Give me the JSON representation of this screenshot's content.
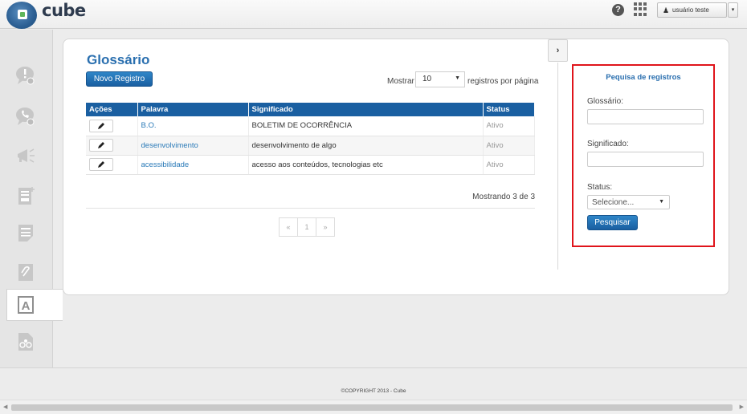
{
  "app": {
    "name": "cube"
  },
  "header": {
    "help_icon": "question-circle-icon",
    "apps_icon": "grid-icon",
    "user_label": "usuário teste",
    "user_icon": "person-icon",
    "caret": "▾"
  },
  "sidebar": {
    "items": [
      {
        "name": "alert-chat-icon"
      },
      {
        "name": "phone-chat-icon"
      },
      {
        "name": "megaphone-icon"
      },
      {
        "name": "add-report-icon"
      },
      {
        "name": "sla-document-icon"
      },
      {
        "name": "attachment-icon"
      },
      {
        "name": "glossary-icon",
        "active": true
      },
      {
        "name": "workflow-document-icon"
      }
    ]
  },
  "main": {
    "title": "Glossário",
    "new_button": "Novo Registro",
    "show_label": "Mostrar",
    "page_size": "10",
    "per_page_label": "registros por página",
    "columns": [
      "Ações",
      "Palavra",
      "Significado",
      "Status"
    ],
    "rows": [
      {
        "palavra": "B.O.",
        "significado": "BOLETIM DE OCORRÊNCIA",
        "status": "Ativo"
      },
      {
        "palavra": "desenvolvimento",
        "significado": "desenvolvimento de algo",
        "status": "Ativo"
      },
      {
        "palavra": "acessibilidade",
        "significado": "acesso aos conteúdos, tecnologias etc",
        "status": "Ativo"
      }
    ],
    "showing": "Mostrando 3 de 3",
    "pagination": {
      "prev": "«",
      "page": "1",
      "next": "»"
    },
    "toggle": "›"
  },
  "search": {
    "title": "Pequisa de registros",
    "glossario_label": "Glossário:",
    "significado_label": "Significado:",
    "status_label": "Status:",
    "status_selected": "Selecione...",
    "submit": "Pesquisar"
  },
  "footer": {
    "copyright": "©COPYRIGHT 2013 - Cube"
  },
  "colors": {
    "primary": "#1a5fa1",
    "link": "#2a7ab8",
    "highlight": "#e0141b"
  }
}
